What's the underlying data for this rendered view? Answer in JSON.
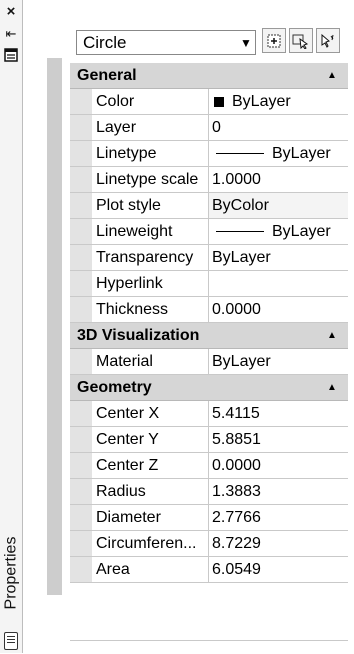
{
  "palette": {
    "title": "Properties",
    "strip_icons": [
      "close-icon",
      "auto-hide-icon",
      "properties-menu-icon"
    ]
  },
  "selector": {
    "value": "Circle",
    "buttons": [
      "toggle-pickadd-button",
      "select-objects-button",
      "quick-select-button"
    ]
  },
  "sections": [
    {
      "title": "General",
      "rows": [
        {
          "name": "Color",
          "value": "ByLayer",
          "kind": "color"
        },
        {
          "name": "Layer",
          "value": "0"
        },
        {
          "name": "Linetype",
          "value": "ByLayer",
          "kind": "line"
        },
        {
          "name": "Linetype scale",
          "value": "1.0000"
        },
        {
          "name": "Plot style",
          "value": "ByColor",
          "shaded": true
        },
        {
          "name": "Lineweight",
          "value": "ByLayer",
          "kind": "line"
        },
        {
          "name": "Transparency",
          "value": "ByLayer"
        },
        {
          "name": "Hyperlink",
          "value": ""
        },
        {
          "name": "Thickness",
          "value": "0.0000"
        }
      ]
    },
    {
      "title": "3D Visualization",
      "rows": [
        {
          "name": "Material",
          "value": "ByLayer"
        }
      ]
    },
    {
      "title": "Geometry",
      "rows": [
        {
          "name": "Center X",
          "value": "5.4115"
        },
        {
          "name": "Center Y",
          "value": "5.8851"
        },
        {
          "name": "Center Z",
          "value": "0.0000"
        },
        {
          "name": "Radius",
          "value": "1.3883"
        },
        {
          "name": "Diameter",
          "value": "2.7766"
        },
        {
          "name": "Circumferen...",
          "value": "8.7229"
        },
        {
          "name": "Area",
          "value": "6.0549"
        }
      ]
    }
  ]
}
